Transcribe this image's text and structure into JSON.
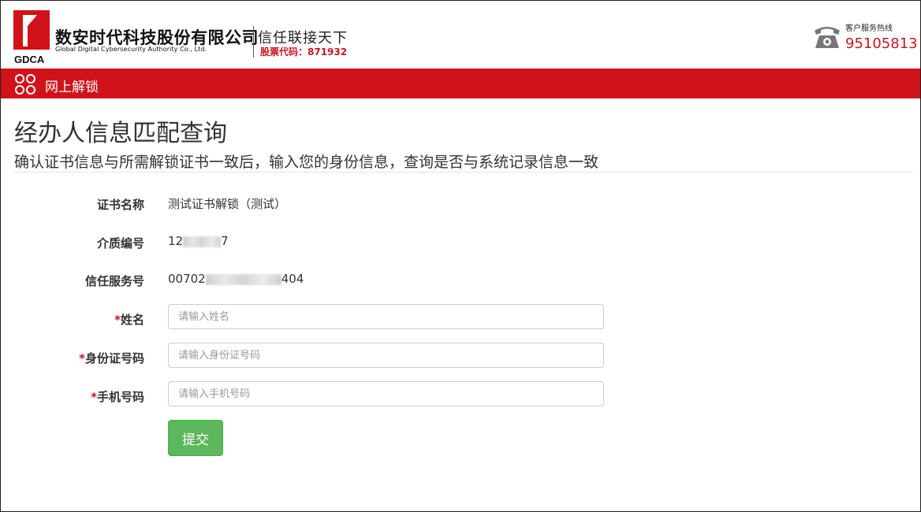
{
  "header": {
    "company_cn": "数安时代科技股份有限公司",
    "company_en": "Global Digital Cybersecurity Authority Co., Ltd.",
    "logo_text": "GDCA",
    "slogan": "信任联接天下",
    "stock_code": "股票代码：871932",
    "hotline_label": "客户服务热线",
    "hotline_number": "95105813"
  },
  "nav": {
    "title": "网上解锁",
    "icon": "grid-icon"
  },
  "page": {
    "title": "经办人信息匹配查询",
    "subtitle": "确认证书信息与所需解锁证书一致后，输入您的身份信息，查询是否与系统记录信息一致"
  },
  "info": {
    "cert_name_label": "证书名称",
    "cert_name_value": "测试证书解锁（测试）",
    "media_no_label": "介质编号",
    "media_no_prefix": "12",
    "media_no_suffix": "7",
    "trust_no_label": "信任服务号",
    "trust_no_prefix": "00702",
    "trust_no_suffix": "404"
  },
  "form": {
    "required_mark": "*",
    "name_label": "姓名",
    "name_placeholder": "请输入姓名",
    "id_label": "身份证号码",
    "id_placeholder": "请输入身份证号码",
    "phone_label": "手机号码",
    "phone_placeholder": "请输入手机号码",
    "submit_label": "提交"
  },
  "colors": {
    "brand_red": "#d0121b",
    "submit_green": "#5cb85c"
  }
}
